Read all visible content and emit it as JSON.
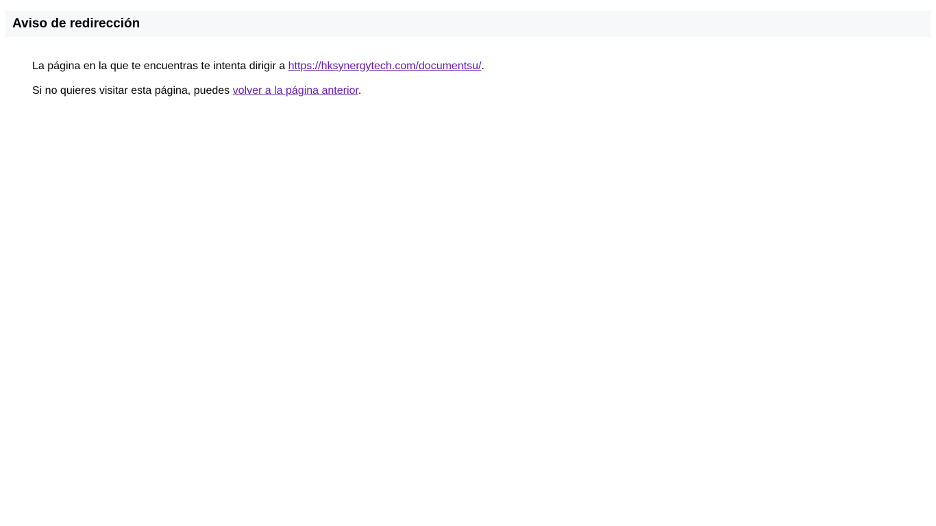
{
  "header": {
    "title": "Aviso de redirección"
  },
  "message": {
    "line1_prefix": "La página en la que te encuentras te intenta dirigir a ",
    "target_link_text": "https://hksynergytech.com/documentsu/",
    "line1_suffix": ".",
    "line2_prefix": "Si no quieres visitar esta página, puedes ",
    "back_link_text": "volver a la página anterior",
    "line2_suffix": "."
  },
  "colors": {
    "header_background": "#f7f8fa",
    "visited_link": "#681da8",
    "text": "#000000"
  }
}
